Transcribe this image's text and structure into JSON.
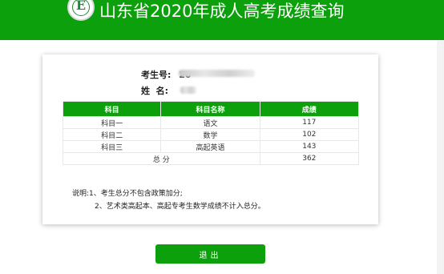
{
  "header": {
    "title": "山东省2020年成人高考成绩查询",
    "logo_letter": "E",
    "bg_color": "#0ca10c"
  },
  "info": {
    "exam_number_label": "考生号:",
    "exam_number_value": "20",
    "name_label": "姓  名:"
  },
  "table": {
    "headers": [
      "科目",
      "科目名称",
      "成绩"
    ],
    "rows": [
      [
        "科目一",
        "语文",
        "117"
      ],
      [
        "科目二",
        "数学",
        "102"
      ],
      [
        "科目三",
        "高起英语",
        "143"
      ]
    ],
    "total_label": "总 分",
    "total_value": "362"
  },
  "notes": {
    "line1": "说明:1、考生总分不包含政策加分;",
    "line2": "2、艺术类高起本、高起专考生数学成绩不计入总分。"
  },
  "buttons": {
    "exit_label": "退出"
  }
}
